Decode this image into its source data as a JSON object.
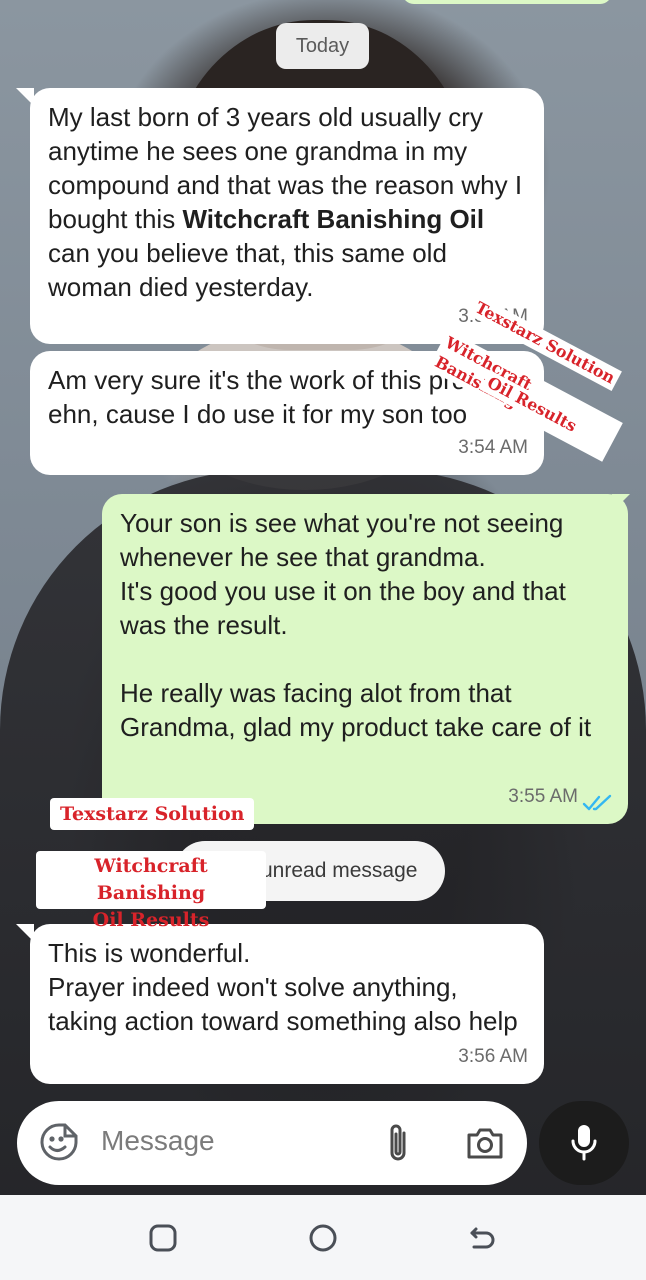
{
  "date_chip": "Today",
  "messages": [
    {
      "id": "m1",
      "direction": "incoming",
      "text_before_bold": "My last born of 3 years old usually cry anytime he sees one grandma in my compound and that was the reason why I bought this ",
      "text_bold": "Witchcraft Banishing Oil",
      "text_after_bold": " can you believe that, this same old woman died yesterday.",
      "time": "3:54 AM"
    },
    {
      "id": "m2",
      "direction": "incoming",
      "text": "Am very sure it's the work of this product ehn, cause I do use it for my son too",
      "time": "3:54 AM"
    },
    {
      "id": "m3",
      "direction": "outgoing",
      "text": "Your son is see what you're not seeing whenever he see that grandma.\nIt's good you use it on the boy and that was the result.\n\nHe really was facing alot from that Grandma, glad my product take care of it",
      "time": "3:55 AM",
      "status": "read-double-check"
    },
    {
      "id": "m4",
      "direction": "incoming",
      "text": "This is wonderful.\nPrayer indeed won't solve anything, taking action toward something also help",
      "time": "3:56 AM"
    }
  ],
  "unread_banner": "unread message",
  "watermarks": {
    "brand": "Texstarz Solution",
    "caption_line1": "Witchcraft Banishing",
    "caption_line2": "Oil Results"
  },
  "composer": {
    "placeholder": "Message",
    "icons": [
      "emoji-icon",
      "attach-icon",
      "camera-icon",
      "mic-icon"
    ]
  },
  "navbar_icons": [
    "recents-icon",
    "home-icon",
    "back-icon"
  ],
  "colors": {
    "outgoing_bubble": "#dcf8c6",
    "incoming_bubble": "#ffffff",
    "read_ticks": "#34b7f1",
    "watermark_text": "#d8232a"
  }
}
